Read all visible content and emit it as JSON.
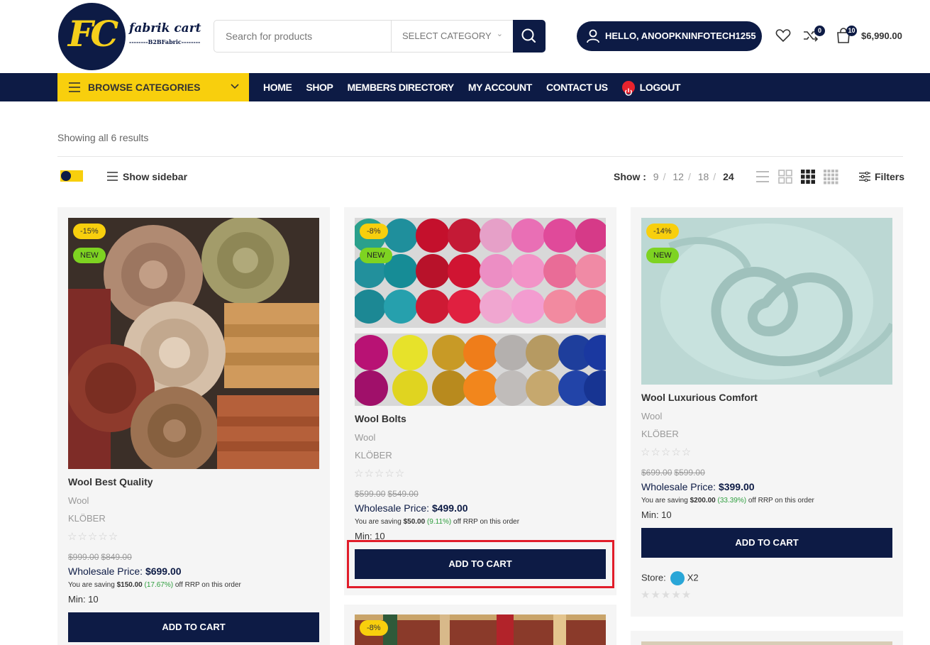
{
  "header": {
    "logo_text": "FC",
    "brand_name": "fabrik cart",
    "brand_tagline": "--------B2BFabric--------",
    "search_placeholder": "Search for products",
    "category_select": "SELECT CATEGORY",
    "hello_label": "HELLO, ANOOPKNINFOTECH1255",
    "compare_count": "0",
    "cart_count": "10",
    "cart_total": "$6,990.00"
  },
  "nav": {
    "browse_label": "BROWSE CATEGORIES",
    "items": [
      "HOME",
      "SHOP",
      "MEMBERS DIRECTORY",
      "MY ACCOUNT",
      "CONTACT US"
    ],
    "logout_label": "LOGOUT"
  },
  "toolbar": {
    "results_text": "Showing all 6 results",
    "show_sidebar": "Show sidebar",
    "show_label": "Show :",
    "per_page_options": [
      "9",
      "12",
      "18",
      "24"
    ],
    "per_page_active": "24",
    "filters_label": "Filters"
  },
  "products": [
    {
      "sale_badge": "-15%",
      "new_badge": "NEW",
      "title": "Wool Best Quality",
      "category": "Wool",
      "brand": "KLÖBER",
      "stars": "☆☆☆☆☆",
      "old_price": "$999.00",
      "price": "$849.00",
      "wholesale_label": "Wholesale Price:",
      "wholesale_price": "$699.00",
      "saving_prefix": "You are saving",
      "saving_amount": "$150.00",
      "saving_pct": "(17.67%)",
      "saving_suffix": "off RRP on this order",
      "min": "Min: 10",
      "cta": "ADD TO CART"
    },
    {
      "sale_badge": "-8%",
      "new_badge": "NEW",
      "title": "Wool Bolts",
      "category": "Wool",
      "brand": "KLÖBER",
      "stars": "☆☆☆☆☆",
      "old_price": "$599.00",
      "price": "$549.00",
      "wholesale_label": "Wholesale Price:",
      "wholesale_price": "$499.00",
      "saving_prefix": "You are saving",
      "saving_amount": "$50.00",
      "saving_pct": "(9.11%)",
      "saving_suffix": "off RRP on this order",
      "min": "Min: 10",
      "cta": "ADD TO CART"
    },
    {
      "sale_badge": "-14%",
      "new_badge": "NEW",
      "title": "Wool Luxurious Comfort",
      "category": "Wool",
      "brand": "KLÖBER",
      "stars": "☆☆☆☆☆",
      "old_price": "$699.00",
      "price": "$599.00",
      "wholesale_label": "Wholesale Price:",
      "wholesale_price": "$399.00",
      "saving_prefix": "You are saving",
      "saving_amount": "$200.00",
      "saving_pct": "(33.39%)",
      "saving_suffix": "off RRP on this order",
      "min": "Min: 10",
      "cta": "ADD TO CART",
      "store_label": "Store:",
      "store_name": "X2",
      "store_stars": "★★★★★"
    },
    {
      "sale_badge": "-8%"
    }
  ],
  "colors": {
    "navy": "#0d1b45",
    "yellow": "#f8cf0d",
    "new_green": "#7ed321",
    "highlight_red": "#e11d2a"
  }
}
